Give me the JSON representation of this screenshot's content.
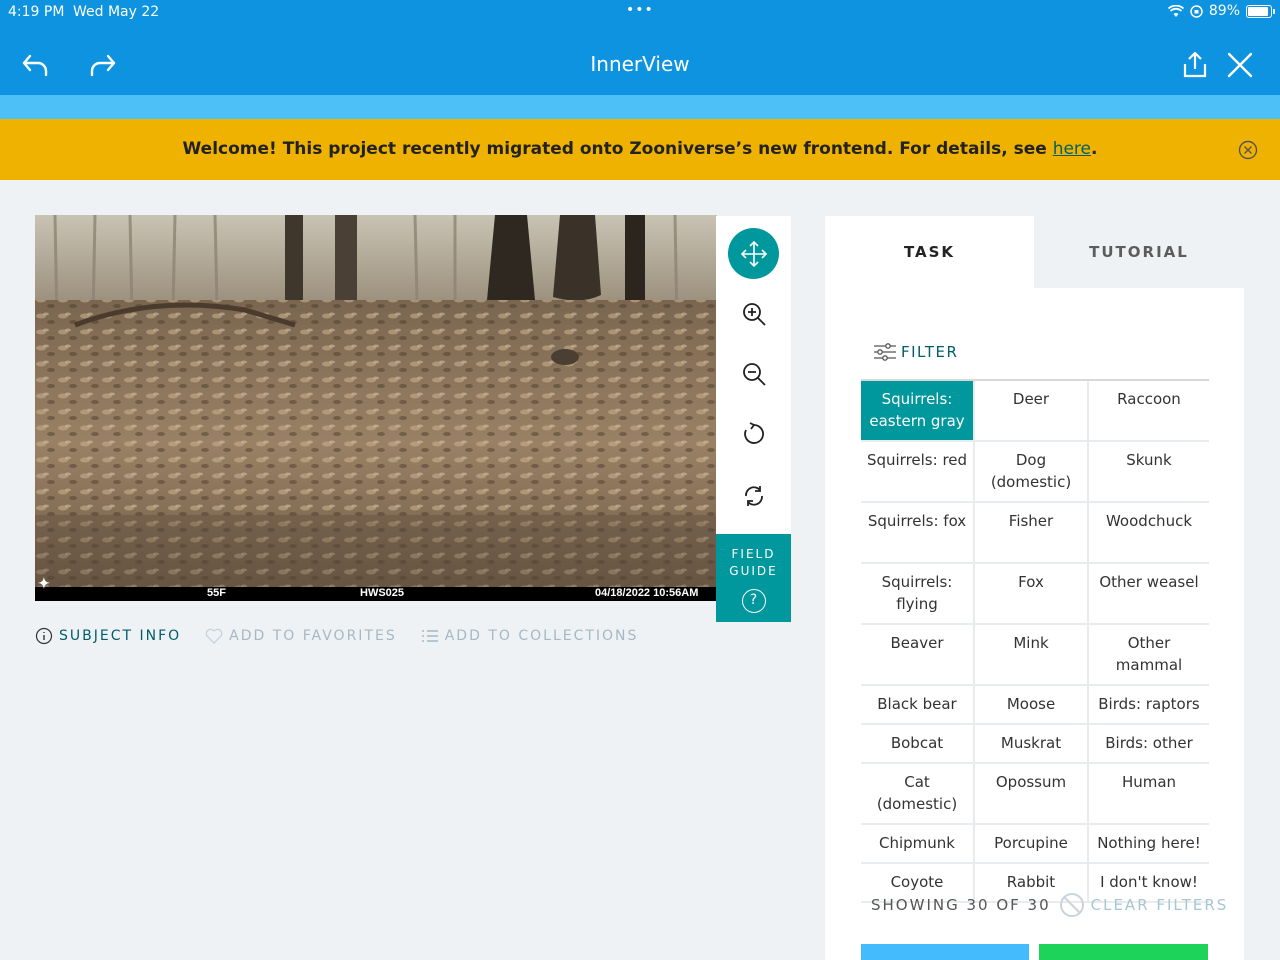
{
  "status_bar": {
    "time": "4:19 PM",
    "date": "Wed May 22",
    "battery": "89%",
    "battery_level": 0.89
  },
  "app_bar": {
    "title": "InnerView",
    "back_icon": "undo-arrow-icon",
    "forward_icon": "redo-arrow-icon",
    "share_icon": "share-icon",
    "close_icon": "close-icon"
  },
  "banner": {
    "message": "Welcome! This project recently migrated onto Zooniverse’s new frontend. For details, see ",
    "link_text": "here",
    "suffix": ".",
    "background": "#f0b200"
  },
  "subject": {
    "overlay": {
      "temperature": "55F",
      "camera_id": "HWS025",
      "timestamp": "04/18/2022 10:56AM"
    }
  },
  "toolbar": {
    "tools": [
      "move-icon",
      "zoom-in-icon",
      "zoom-out-icon",
      "rotate-icon",
      "reset-icon"
    ],
    "field_guide_line1": "FIELD",
    "field_guide_line2": "GUIDE",
    "help_glyph": "?"
  },
  "meta": {
    "subject_info": "SUBJECT INFO",
    "add_to_favorites": "ADD TO FAVORITES",
    "add_to_collections": "ADD TO COLLECTIONS"
  },
  "panel": {
    "tabs": [
      {
        "label": "TASK"
      },
      {
        "label": "TUTORIAL"
      }
    ],
    "filter_label": "FILTER",
    "choices": [
      [
        "Squirrels: eastern gray",
        "Deer",
        "Raccoon"
      ],
      [
        "Squirrels: red",
        "Dog (domestic)",
        "Skunk"
      ],
      [
        "Squirrels: fox",
        "Fisher",
        "Woodchuck"
      ],
      [
        "Squirrels: flying",
        "Fox",
        "Other weasel"
      ],
      [
        "Beaver",
        "Mink",
        "Other mammal"
      ],
      [
        "Black bear",
        "Moose",
        "Birds: raptors"
      ],
      [
        "Bobcat",
        "Muskrat",
        "Birds: other"
      ],
      [
        "Cat (domestic)",
        "Opossum",
        "Human"
      ],
      [
        "Chipmunk",
        "Porcupine",
        "Nothing here!"
      ],
      [
        "Coyote",
        "Rabbit",
        "I don't know!"
      ]
    ],
    "selected": "Squirrels: eastern gray",
    "showing": "SHOWING 30 OF 30",
    "clear_filters": "CLEAR FILTERS",
    "accent_color": "#00979d"
  }
}
